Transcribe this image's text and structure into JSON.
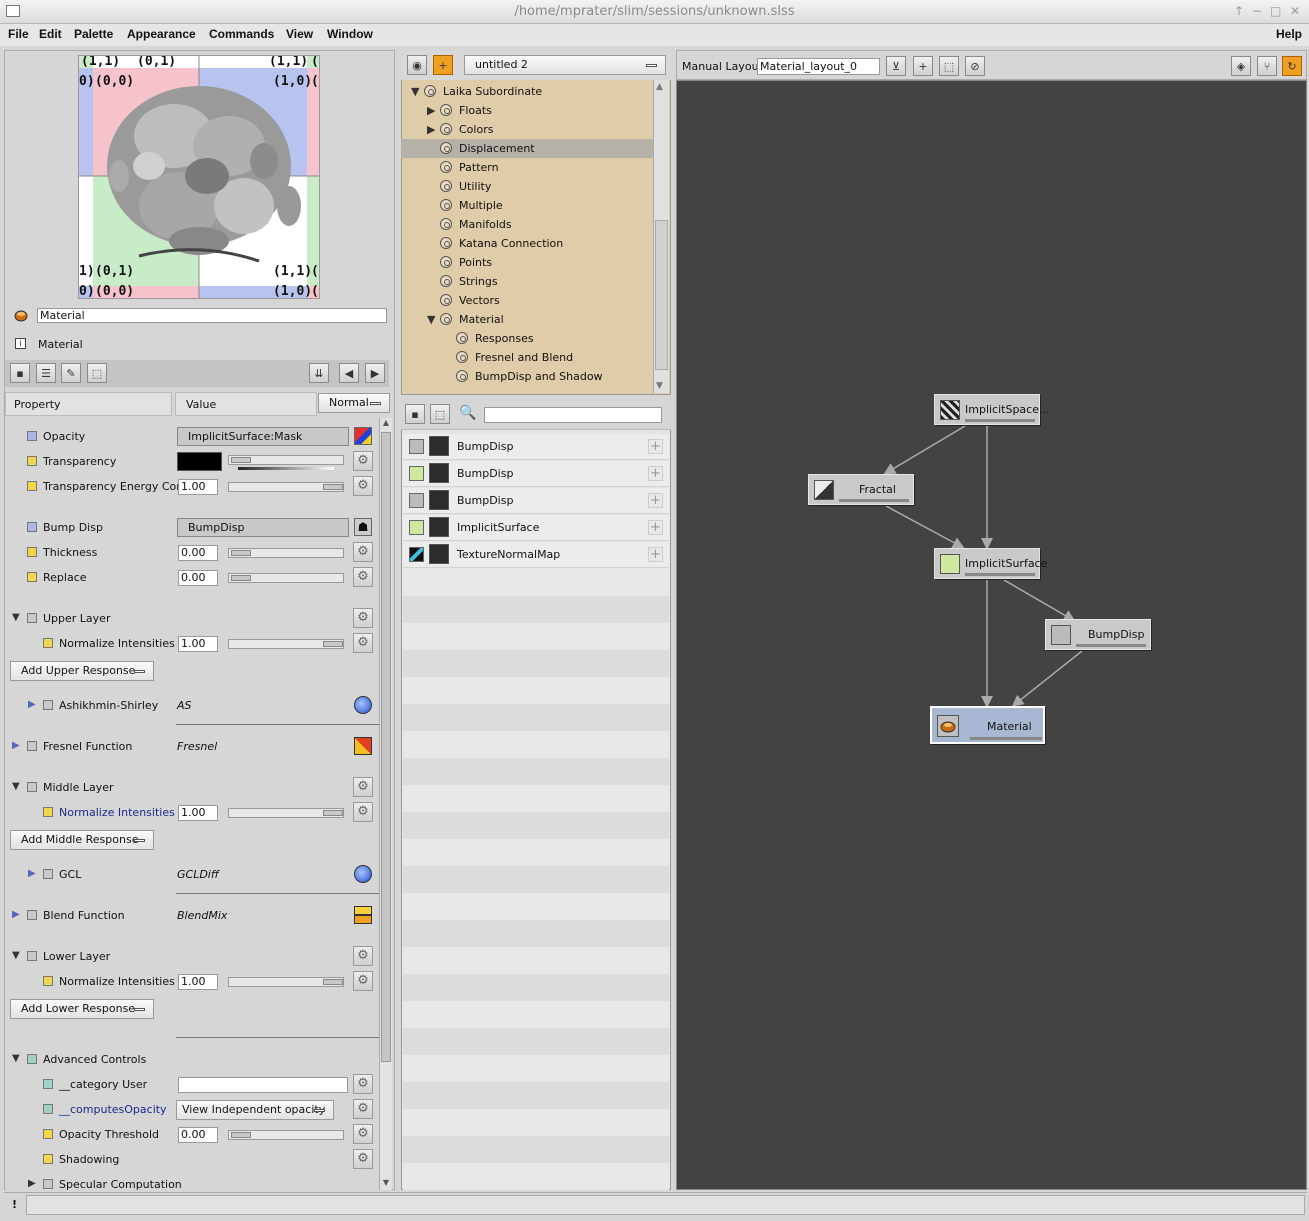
{
  "window": {
    "title": "/home/mprater/slim/sessions/unknown.slss"
  },
  "menu": [
    "File",
    "Edit",
    "Palette",
    "Appearance",
    "Commands",
    "View",
    "Window"
  ],
  "help": "Help",
  "preview": {
    "labels_top": [
      "(1,1)",
      "(0,1)",
      "(1,1)",
      "(0"
    ],
    "labels_row2": [
      "0)",
      "(0,0)",
      "(1,0)",
      "(0"
    ],
    "labels_row3": [
      "1)",
      "(0,1)",
      "(1,1)",
      "(0"
    ],
    "labels_bottom": [
      "0)",
      "(0,0)",
      "(1,0)",
      "(0"
    ]
  },
  "material": {
    "name_value": "Material",
    "type_label": "Material"
  },
  "prop_header": {
    "property": "Property",
    "value": "Value",
    "mode": "Normal"
  },
  "props": {
    "opacity": {
      "name": "Opacity",
      "value": "ImplicitSurface:Mask"
    },
    "transparency": {
      "name": "Transparency"
    },
    "transparency_energy": {
      "name": "Transparency Energy Conse",
      "value": "1.00"
    },
    "bump_disp": {
      "name": "Bump Disp",
      "value": "BumpDisp"
    },
    "thickness": {
      "name": "Thickness",
      "value": "0.00"
    },
    "replace": {
      "name": "Replace",
      "value": "0.00"
    },
    "upper_layer": {
      "name": "Upper Layer"
    },
    "upper_norm": {
      "name": "Normalize Intensities",
      "value": "1.00"
    },
    "add_upper": "Add Upper Response",
    "ashikhmin": {
      "name": "Ashikhmin-Shirley",
      "value": "AS"
    },
    "fresnel": {
      "name": "Fresnel Function",
      "value": "Fresnel"
    },
    "middle_layer": {
      "name": "Middle Layer"
    },
    "middle_norm": {
      "name": "Normalize Intensities",
      "value": "1.00"
    },
    "add_middle": "Add Middle Response",
    "gcl": {
      "name": "GCL",
      "value": "GCLDiff"
    },
    "blend": {
      "name": "Blend Function",
      "value": "BlendMix"
    },
    "lower_layer": {
      "name": "Lower Layer"
    },
    "lower_norm": {
      "name": "Normalize Intensities",
      "value": "1.00"
    },
    "add_lower": "Add Lower Response",
    "advanced": {
      "name": "Advanced Controls"
    },
    "category": {
      "name": "__category User",
      "value": ""
    },
    "computes_opacity": {
      "name": "__computesOpacity",
      "value": "View Independent opacity"
    },
    "opacity_threshold": {
      "name": "Opacity Threshold",
      "value": "0.00"
    },
    "shadowing": {
      "name": "Shadowing"
    },
    "specular": {
      "name": "Specular Computation"
    }
  },
  "palette": {
    "selector": "untitled 2"
  },
  "tree": [
    {
      "label": "Laika Subordinate",
      "level": 0,
      "expander": "open"
    },
    {
      "label": "Floats",
      "level": 1,
      "expander": "closed"
    },
    {
      "label": "Colors",
      "level": 1,
      "expander": "closed"
    },
    {
      "label": "Displacement",
      "level": 1,
      "expander": "none",
      "selected": true
    },
    {
      "label": "Pattern",
      "level": 1,
      "expander": "none"
    },
    {
      "label": "Utility",
      "level": 1,
      "expander": "none"
    },
    {
      "label": "Multiple",
      "level": 1,
      "expander": "none"
    },
    {
      "label": "Manifolds",
      "level": 1,
      "expander": "none"
    },
    {
      "label": "Katana Connection",
      "level": 1,
      "expander": "none"
    },
    {
      "label": "Points",
      "level": 1,
      "expander": "none"
    },
    {
      "label": "Strings",
      "level": 1,
      "expander": "none"
    },
    {
      "label": "Vectors",
      "level": 1,
      "expander": "none"
    },
    {
      "label": "Material",
      "level": 1,
      "expander": "open"
    },
    {
      "label": "Responses",
      "level": 2,
      "expander": "none"
    },
    {
      "label": "Fresnel and Blend",
      "level": 2,
      "expander": "none"
    },
    {
      "label": "BumpDisp and Shadow",
      "level": 2,
      "expander": "none"
    }
  ],
  "search": {
    "value": ""
  },
  "list_items": [
    {
      "label": "BumpDisp",
      "icon": "bump-icon"
    },
    {
      "label": "BumpDisp",
      "icon": "implicit-icon"
    },
    {
      "label": "BumpDisp",
      "icon": "bump-icon"
    },
    {
      "label": "ImplicitSurface",
      "icon": "implicit-icon"
    },
    {
      "label": "TextureNormalMap",
      "icon": "normalmap-icon"
    }
  ],
  "graph": {
    "layout_label": "Manual Layout",
    "layout_value": "Material_layout_0",
    "nodes": {
      "implicit_space": "ImplicitSpace...",
      "fractal": "Fractal",
      "implicit_surface": "ImplicitSurface",
      "bumpdisp": "BumpDisp",
      "material": "Material"
    }
  },
  "status": {
    "icon_text": "!"
  },
  "colors": {
    "tree_bg": "#dfcca8",
    "graph_bg": "#434343",
    "selected_node": "#a9b8d2",
    "accent": "#f0a020"
  }
}
